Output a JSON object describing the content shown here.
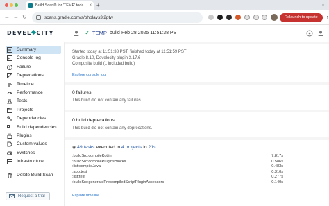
{
  "browser": {
    "tab_title": "Build Scan® for 'TEMP' toda...",
    "tab_close": "×",
    "new_tab": "+",
    "tab_menu": "⌄",
    "back": "←",
    "forward": "→",
    "reload": "↻",
    "url": "scans.gradle.com/s/bhblays3l2ptw",
    "relaunch_label": "Relaunch to update",
    "menu": "⋮"
  },
  "header": {
    "logo": "DEVELOCITY",
    "project": "TEMP",
    "task": "build",
    "timestamp": "Feb 28 2025 11:51:38 PST",
    "status_icon": "check-icon",
    "status_color": "#1aa260"
  },
  "sidebar": {
    "items": [
      {
        "label": "Summary",
        "icon": "summary-icon",
        "active": true
      },
      {
        "label": "Console log",
        "icon": "console-icon"
      },
      {
        "label": "Failure",
        "icon": "failure-icon"
      },
      {
        "label": "Deprecations",
        "icon": "deprecations-icon"
      },
      {
        "label": "Timeline",
        "icon": "timeline-icon"
      },
      {
        "label": "Performance",
        "icon": "performance-icon"
      },
      {
        "label": "Tests",
        "icon": "tests-icon"
      },
      {
        "label": "Projects",
        "icon": "projects-icon"
      },
      {
        "label": "Dependencies",
        "icon": "dependencies-icon"
      },
      {
        "label": "Build dependencies",
        "icon": "build-dependencies-icon"
      },
      {
        "label": "Plugins",
        "icon": "plugins-icon"
      },
      {
        "label": "Custom values",
        "icon": "custom-values-icon"
      },
      {
        "label": "Switches",
        "icon": "switches-icon"
      },
      {
        "label": "Infrastructure",
        "icon": "infrastructure-icon"
      }
    ],
    "delete_label": "Delete Build Scan",
    "trial_label": "Request a trial",
    "active_color": "#cfe4f5"
  },
  "summary": {
    "started": "Started today at 11:51:38 PST, finished today at 11:51:59 PST",
    "gradle": "Gradle 8.10,  Develocity plugin 3.17.6",
    "composite": "Composite build (1 included build)",
    "console_link": "Explore console log"
  },
  "failures": {
    "title": "0 failures",
    "body": "This build did not contain any failures."
  },
  "deprecations": {
    "title": "0 build deprecations",
    "body": "This build did not contain any deprecations."
  },
  "tasks": {
    "count": "49 tasks",
    "mid": "executed in",
    "projects": "4 projects",
    "in": "in",
    "duration": "21s",
    "rows": [
      {
        "name": ":buildSrc:compileKotlin",
        "time": "7.817s"
      },
      {
        "name": ":buildSrc:compilePluginsBlocks",
        "time": "0.586s"
      },
      {
        "name": ":list:compileJava",
        "time": "0.483s"
      },
      {
        "name": ":app:test",
        "time": "0.310s"
      },
      {
        "name": ":list:test",
        "time": "0.277s"
      },
      {
        "name": ":buildSrc:generatePrecompiledScriptPluginAccessors",
        "time": "0.140s"
      }
    ],
    "timeline_link": "Explore timeline"
  }
}
